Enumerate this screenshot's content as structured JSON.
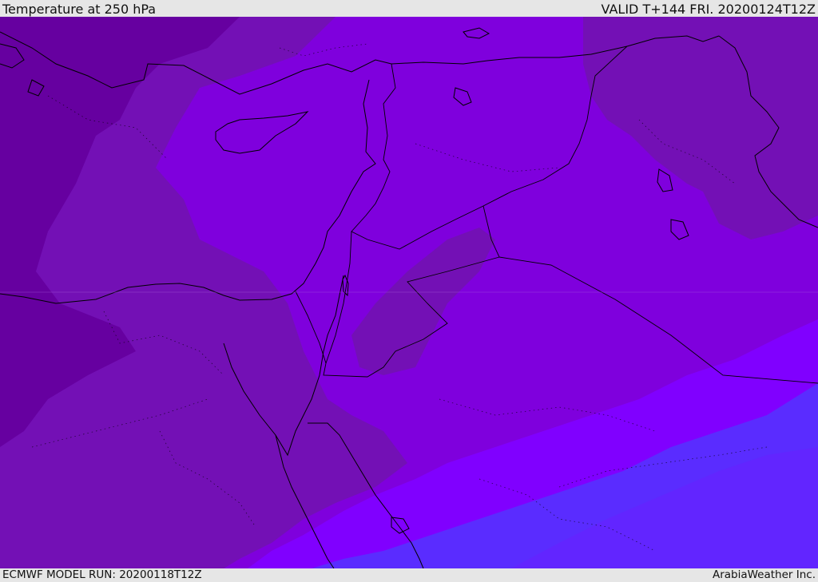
{
  "header": {
    "title": "Temperature at 250 hPa",
    "valid": "VALID T+144 FRI. 20200124T12Z"
  },
  "footer": {
    "model_run": "ECMWF MODEL RUN: 20200118T12Z",
    "credit": "ArabiaWeather Inc."
  },
  "colors": {
    "band_coldest": "#6600a0",
    "band_cold": "#7310b5",
    "band_mid": "#7f00dd",
    "band_warm": "#8000ff",
    "band_warmest": "#5a2cff",
    "coast_lines": "#000000",
    "frame": "#e6e6e6"
  }
}
